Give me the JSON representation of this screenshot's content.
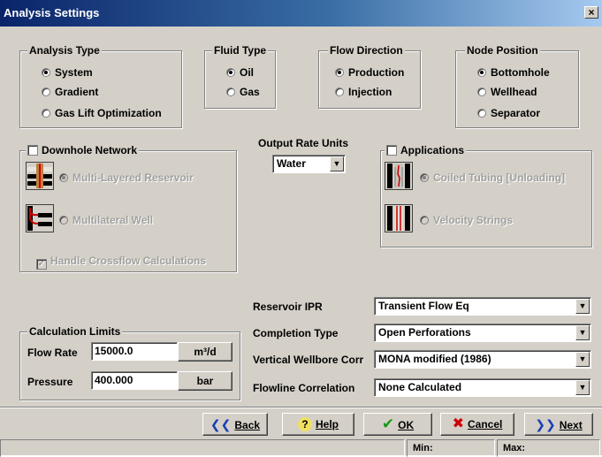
{
  "window": {
    "title": "Analysis Settings",
    "close": "×"
  },
  "analysis_type": {
    "title": "Analysis Type",
    "options": [
      "System",
      "Gradient",
      "Gas Lift Optimization"
    ],
    "selected": "System"
  },
  "fluid_type": {
    "title": "Fluid Type",
    "options": [
      "Oil",
      "Gas"
    ],
    "selected": "Oil"
  },
  "flow_direction": {
    "title": "Flow Direction",
    "options": [
      "Production",
      "Injection"
    ],
    "selected": "Production"
  },
  "node_position": {
    "title": "Node Position",
    "options": [
      "Bottomhole",
      "Wellhead",
      "Separator"
    ],
    "selected": "Bottomhole"
  },
  "downhole_network": {
    "title": "Downhole Network",
    "checked": false,
    "options": [
      "Multi-Layered Reservoir",
      "Multilateral Well"
    ],
    "crossflow_label": "Handle Crossflow Calculations",
    "crossflow_checked": true
  },
  "output_rate_units": {
    "label": "Output Rate Units",
    "value": "Water"
  },
  "applications": {
    "title": "Applications",
    "checked": false,
    "options": [
      "Coiled Tubing [Unloading]",
      "Velocity Strings"
    ]
  },
  "calculation_limits": {
    "title": "Calculation Limits",
    "flow_rate_label": "Flow Rate",
    "flow_rate_value": "15000.0",
    "flow_rate_unit": "m³/d",
    "pressure_label": "Pressure",
    "pressure_value": "400.000",
    "pressure_unit": "bar"
  },
  "correlations": {
    "reservoir_ipr": {
      "label": "Reservoir IPR",
      "value": "Transient Flow Eq"
    },
    "completion_type": {
      "label": "Completion Type",
      "value": "Open Perforations"
    },
    "vertical_wellbore": {
      "label": "Vertical Wellbore Corr",
      "value": "MONA modified (1986)"
    },
    "flowline": {
      "label": "Flowline Correlation",
      "value": "None Calculated"
    }
  },
  "buttons": {
    "back": {
      "label": "Back",
      "icon": "double-left-arrow-icon"
    },
    "help": {
      "label": "Help",
      "icon": "question-icon"
    },
    "ok": {
      "label": "OK",
      "icon": "checkmark-icon"
    },
    "cancel": {
      "label": "Cancel",
      "icon": "x-mark-icon"
    },
    "next": {
      "label": "Next",
      "icon": "double-right-arrow-icon"
    }
  },
  "status": {
    "min_label": "Min:",
    "max_label": "Max:"
  },
  "colors": {
    "title_start": "#0a246a",
    "dialog_bg": "#d4d0c8",
    "ok_check": "#1a9a1a",
    "cancel_x": "#cc0000",
    "nav_arrows": "#1a3fb5"
  }
}
